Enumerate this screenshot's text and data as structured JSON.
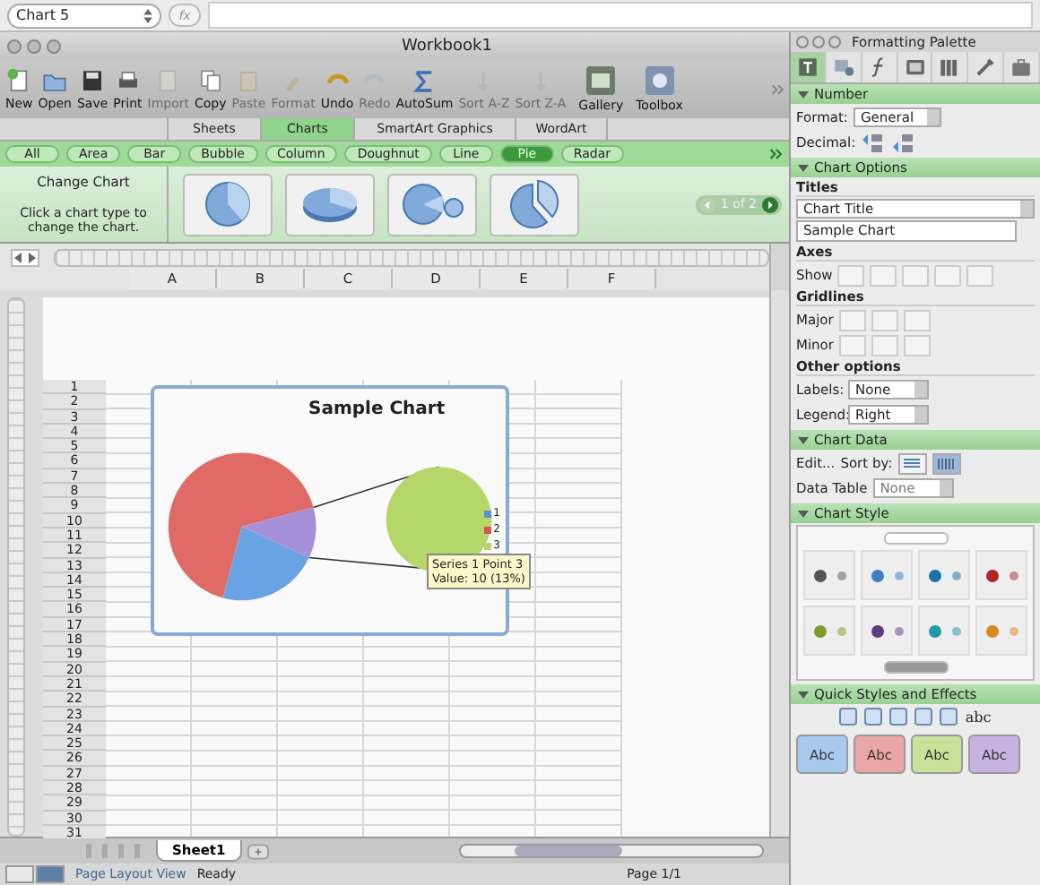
{
  "formula_bar": {
    "name_box": "Chart 5",
    "fx": "fx"
  },
  "window": {
    "title": "Workbook1"
  },
  "toolbar": [
    {
      "kind": "new",
      "label": "New",
      "disabled": false
    },
    {
      "kind": "open",
      "label": "Open",
      "disabled": false
    },
    {
      "kind": "save",
      "label": "Save",
      "disabled": false
    },
    {
      "kind": "print",
      "label": "Print",
      "disabled": false
    },
    {
      "kind": "import",
      "label": "Import",
      "disabled": true
    },
    {
      "kind": "copy",
      "label": "Copy",
      "disabled": false
    },
    {
      "kind": "paste",
      "label": "Paste",
      "disabled": true
    },
    {
      "kind": "format",
      "label": "Format",
      "disabled": true
    },
    {
      "kind": "undo",
      "label": "Undo",
      "disabled": false
    },
    {
      "kind": "redo",
      "label": "Redo",
      "disabled": true
    },
    {
      "kind": "autosum",
      "label": "AutoSum",
      "disabled": false
    },
    {
      "kind": "sortaz",
      "label": "Sort A-Z",
      "disabled": true
    },
    {
      "kind": "sortza",
      "label": "Sort Z-A",
      "disabled": true
    },
    {
      "kind": "gallery",
      "label": "Gallery",
      "disabled": false
    },
    {
      "kind": "toolbox",
      "label": "Toolbox",
      "disabled": false
    }
  ],
  "ribbon_tabs": [
    {
      "label": "Sheets",
      "selected": false
    },
    {
      "label": "Charts",
      "selected": true
    },
    {
      "label": "SmartArt Graphics",
      "selected": false
    },
    {
      "label": "WordArt",
      "selected": false
    }
  ],
  "chart_types": [
    {
      "label": "All",
      "selected": false
    },
    {
      "label": "Area",
      "selected": false
    },
    {
      "label": "Bar",
      "selected": false
    },
    {
      "label": "Bubble",
      "selected": false
    },
    {
      "label": "Column",
      "selected": false
    },
    {
      "label": "Doughnut",
      "selected": false
    },
    {
      "label": "Line",
      "selected": false
    },
    {
      "label": "Pie",
      "selected": true
    },
    {
      "label": "Radar",
      "selected": false
    }
  ],
  "gallery": {
    "title": "Change Chart",
    "hint": "Click a chart type to change the chart.",
    "thumbnails": [
      {
        "kind": "pie"
      },
      {
        "kind": "pie3d"
      },
      {
        "kind": "pieofpie"
      },
      {
        "kind": "exploded"
      }
    ],
    "pager": "1 of 2"
  },
  "columns": [
    "A",
    "B",
    "C",
    "D",
    "E",
    "F"
  ],
  "rows": [
    "1",
    "2",
    "3",
    "4",
    "5",
    "6",
    "7",
    "8",
    "9",
    "10",
    "11",
    "12",
    "13",
    "14",
    "15",
    "16",
    "17",
    "18",
    "19",
    "20",
    "21",
    "22",
    "23",
    "24",
    "25",
    "26",
    "27",
    "28",
    "29",
    "30",
    "31"
  ],
  "chart": {
    "title": "Sample Chart",
    "tooltip": [
      "Series 1 Point 3",
      "Value: 10 (13%)"
    ],
    "legend": [
      {
        "label": "1",
        "color": "#5b8fd0"
      },
      {
        "label": "2",
        "color": "#d9534f"
      },
      {
        "label": "3",
        "color": "#b5d46a"
      }
    ]
  },
  "sheet_tabs": [
    {
      "label": "Sheet1",
      "selected": true
    }
  ],
  "status_bar": {
    "view": "Page Layout View",
    "state": "Ready",
    "page": "Page 1/1"
  },
  "palette": {
    "title": "Formatting Palette",
    "tabs": [
      {
        "kind": "text",
        "selected": true
      },
      {
        "kind": "object",
        "selected": false
      },
      {
        "kind": "formula",
        "selected": false
      },
      {
        "kind": "scrapbook",
        "selected": false
      },
      {
        "kind": "reference",
        "selected": false
      },
      {
        "kind": "tools",
        "selected": false
      },
      {
        "kind": "projects",
        "selected": false
      }
    ],
    "number": {
      "header": "Number",
      "expanded": true,
      "format_label": "Format:",
      "format": "General",
      "decimal_label": "Decimal:"
    },
    "chart_options": {
      "header": "Chart Options",
      "expanded": true,
      "titles": "Titles",
      "title_select": "Chart Title",
      "title_value": "Sample Chart",
      "axes": "Axes",
      "show": "Show",
      "gridlines": "Gridlines",
      "major": "Major",
      "minor": "Minor",
      "other": "Other options",
      "labels_label": "Labels:",
      "labels": "None",
      "legend_label": "Legend:",
      "legend": "Right"
    },
    "data_section": {
      "header": "Chart Data",
      "expanded": true,
      "edit": "Edit...",
      "sort_by": "Sort by:",
      "sort": [
        {
          "kind": "rows",
          "selected": false
        },
        {
          "kind": "columns",
          "selected": true
        }
      ],
      "data_table_label": "Data Table",
      "data_table": "None"
    },
    "chart_style": {
      "header": "Chart Style",
      "expanded": true,
      "styles": [
        {
          "color": "#555555"
        },
        {
          "color": "#3b7fc4"
        },
        {
          "color": "#1f6fa8"
        },
        {
          "color": "#b5202a"
        },
        {
          "color": "#7e9a2c"
        },
        {
          "color": "#5a3e80"
        },
        {
          "color": "#1f9aa8"
        },
        {
          "color": "#d98a1f"
        }
      ]
    },
    "quick_styles": {
      "header": "Quick Styles and Effects",
      "expanded": true,
      "text_effect": "abc",
      "samples": [
        {
          "label": "Abc",
          "color": "#a9c8ee"
        },
        {
          "label": "Abc",
          "color": "#eaa6a6"
        },
        {
          "label": "Abc",
          "color": "#c9e29a"
        },
        {
          "label": "Abc",
          "color": "#c6b3e2"
        }
      ]
    }
  }
}
